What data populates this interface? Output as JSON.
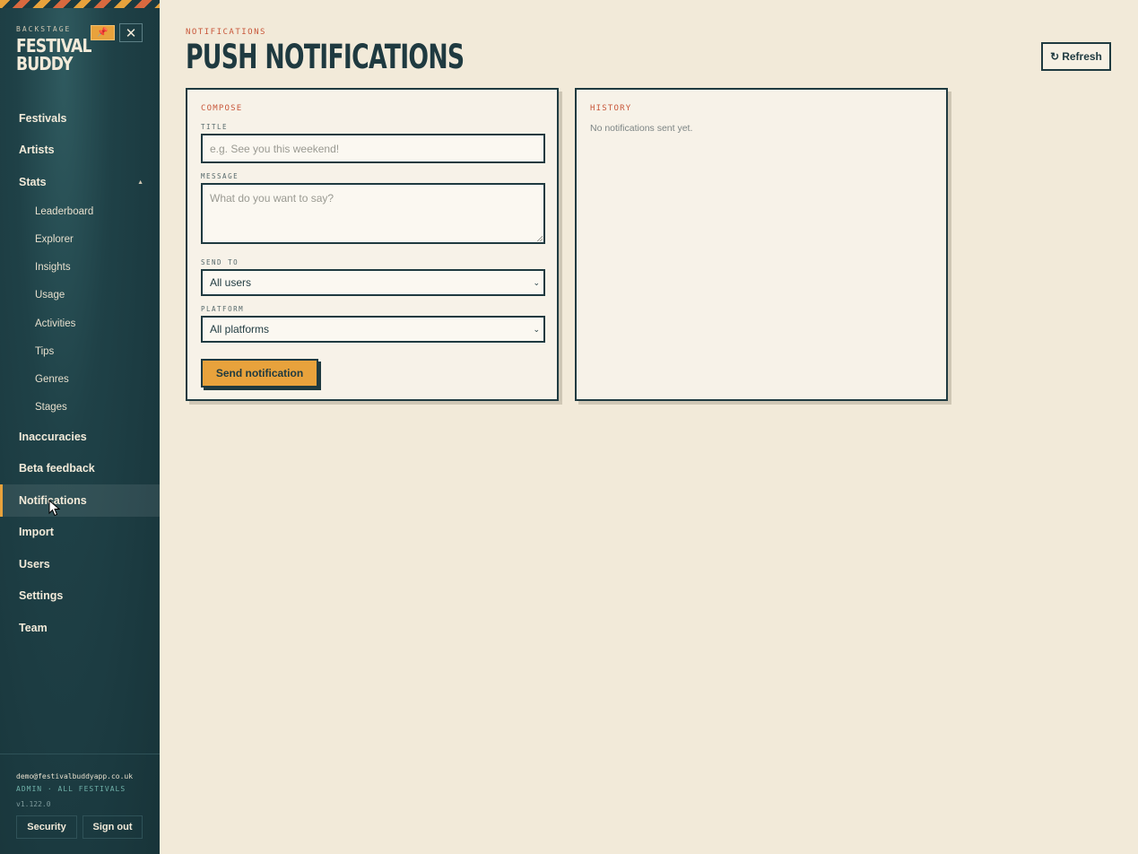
{
  "sidebar": {
    "brand_kicker": "BACKSTAGE",
    "brand_name": "FESTIVAL BUDDY",
    "nav": [
      {
        "label": "Festivals"
      },
      {
        "label": "Artists"
      },
      {
        "label": "Stats"
      },
      {
        "label": "Leaderboard"
      },
      {
        "label": "Explorer"
      },
      {
        "label": "Insights"
      },
      {
        "label": "Usage"
      },
      {
        "label": "Activities"
      },
      {
        "label": "Tips"
      },
      {
        "label": "Genres"
      },
      {
        "label": "Stages"
      },
      {
        "label": "Inaccuracies"
      },
      {
        "label": "Beta feedback"
      },
      {
        "label": "Notifications"
      },
      {
        "label": "Import"
      },
      {
        "label": "Users"
      },
      {
        "label": "Settings"
      },
      {
        "label": "Team"
      }
    ],
    "active_item": "Notifications",
    "footer": {
      "email": "demo@festivalbuddyapp.co.uk",
      "role": "ADMIN · ALL FESTIVALS",
      "version": "v1.122.0",
      "security_label": "Security",
      "signout_label": "Sign out"
    }
  },
  "header": {
    "kicker": "NOTIFICATIONS",
    "title": "PUSH NOTIFICATIONS",
    "refresh_label": "Refresh"
  },
  "compose": {
    "section_label": "COMPOSE",
    "title_label": "TITLE",
    "title_placeholder": "e.g. See you this weekend!",
    "message_label": "MESSAGE",
    "message_placeholder": "What do you want to say?",
    "send_to_label": "SEND TO",
    "send_to_value": "All users",
    "platform_label": "PLATFORM",
    "platform_value": "All platforms",
    "send_label": "Send notification"
  },
  "history": {
    "section_label": "HISTORY",
    "empty_text": "No notifications sent yet."
  },
  "colors": {
    "accent": "#e8a23c",
    "ink": "#1f3a40",
    "kicker": "#c8573a",
    "background": "#f2ead9"
  }
}
